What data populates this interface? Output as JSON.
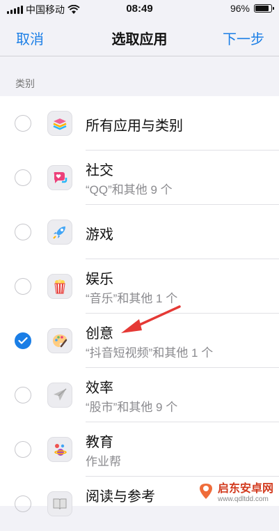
{
  "status_bar": {
    "carrier": "中国移动",
    "time": "08:49",
    "battery_percent": "96%",
    "battery_level": 0.96
  },
  "nav": {
    "cancel": "取消",
    "title": "选取应用",
    "next": "下一步"
  },
  "section_header": "类别",
  "rows": [
    {
      "label": "所有应用与类别",
      "sub": "",
      "checked": false,
      "icon": "stack-icon"
    },
    {
      "label": "社交",
      "sub": "“QQ”和其他 9 个",
      "checked": false,
      "icon": "chat-heart-icon"
    },
    {
      "label": "游戏",
      "sub": "",
      "checked": false,
      "icon": "rocket-icon"
    },
    {
      "label": "娱乐",
      "sub": "“音乐”和其他 1 个",
      "checked": false,
      "icon": "popcorn-icon"
    },
    {
      "label": "创意",
      "sub": "“抖音短视频”和其他 1 个",
      "checked": true,
      "icon": "palette-icon"
    },
    {
      "label": "效率",
      "sub": "“股市”和其他 9 个",
      "checked": false,
      "icon": "paper-plane-icon"
    },
    {
      "label": "教育",
      "sub": "作业帮",
      "checked": false,
      "icon": "planet-icon"
    },
    {
      "label": "阅读与参考",
      "sub": "",
      "checked": false,
      "icon": "book-icon"
    }
  ],
  "watermark": {
    "name": "启东安卓网",
    "url": "www.qdltdd.com"
  },
  "colors": {
    "accent": "#1a7ee6",
    "annotation": "#e53935"
  }
}
